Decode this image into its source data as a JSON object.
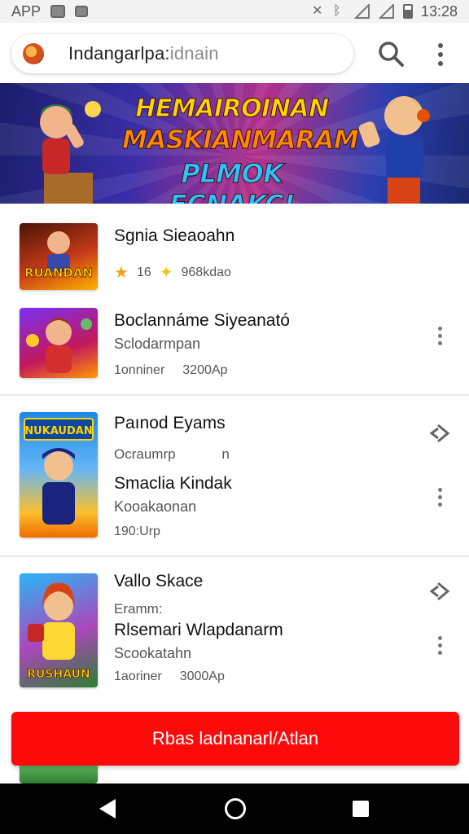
{
  "status_bar": {
    "label": "APP",
    "time": "13:28"
  },
  "search": {
    "query": "Indangarlpa:",
    "placeholder": "idnain"
  },
  "banner": {
    "line1": "HEMAIROINAN",
    "line2": "MASKIANMARAM",
    "line3": "PLMOK FCNAKC!"
  },
  "list": [
    {
      "title": "Sgnia Sieaoahn",
      "rating": "16",
      "reviews": "968kdao"
    },
    {
      "title": "Boclannáme Siyeanató",
      "subtitle": "Sclodarmpan",
      "meta_a": "1onniner",
      "meta_b": "3200Ap"
    },
    {
      "title": "Paınod Eyams",
      "subtitle": "Ocraumrp",
      "subtitle_tail": "n",
      "title2": "Smaclia Kindak",
      "subtitle2": "Kooakaonan",
      "meta_a": "190:Urp"
    },
    {
      "title": "Vallo Skace",
      "subtitle": "Eramm:",
      "title2": "Rlsemari Wlapdanarm",
      "subtitle2": "Scookatahn",
      "meta_a": "1aoriner",
      "meta_b": "3000Ap"
    }
  ],
  "thumbs": {
    "t1": "RUANDAN",
    "t3": "NUKAUDAN",
    "t4": "RUSHAUN"
  },
  "cta": {
    "label": "Rbas ladnanarl/Atlan"
  },
  "colors": {
    "accent": "#ff0a0a",
    "banner_bg": "#3a2ea8"
  },
  "icons": {
    "search": "search-icon",
    "menu": "more-vert-icon",
    "share": "share-icon"
  }
}
